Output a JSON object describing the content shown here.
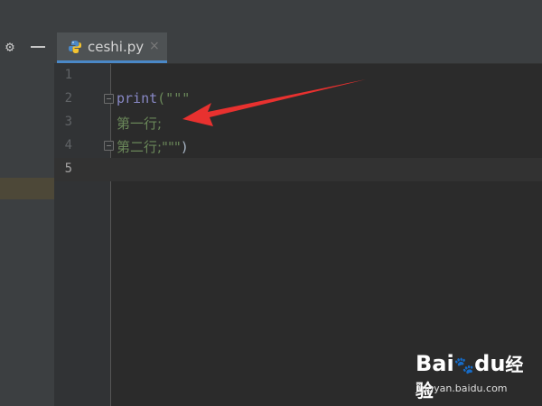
{
  "sidebar": {
    "settings_icon": "gear-icon",
    "hide_icon": "minus-icon"
  },
  "editor": {
    "tab": {
      "filename": "ceshi.py",
      "icon": "python-file-icon",
      "close_glyph": "×"
    },
    "line_numbers": [
      "1",
      "2",
      "3",
      "4",
      "5"
    ],
    "current_line": 5,
    "code_lines": {
      "line2_func": "print",
      "line2_rest": "(\"\"\"",
      "line3_text": "第一行;",
      "line4_text": "第二行;\"\"\"",
      "line4_paren": ")"
    }
  },
  "annotation": {
    "arrow_color": "#e8312f"
  },
  "watermark": {
    "logo_text": "Bai",
    "logo_text2": "du",
    "logo_cn": "经验",
    "url": "jingyan.baidu.com"
  },
  "colors": {
    "background": "#2b2b2b",
    "panel": "#3c3f41",
    "keyword": "#8888c6",
    "string": "#6a8759",
    "tab_underline": "#4a88c7"
  }
}
